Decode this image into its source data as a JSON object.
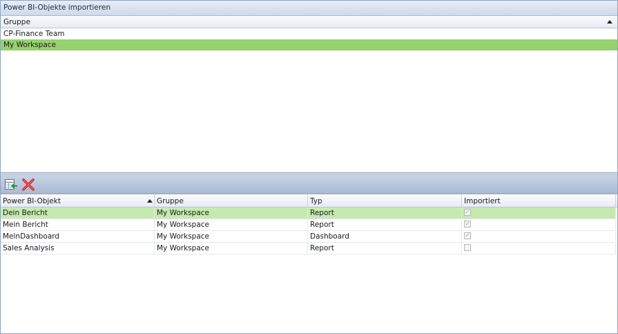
{
  "window": {
    "title": "Power BI-Objekte importieren"
  },
  "groups": {
    "header": "Gruppe",
    "items": [
      {
        "label": "CP-Finance Team",
        "selected": false
      },
      {
        "label": "My Workspace",
        "selected": true
      }
    ]
  },
  "toolbar": {
    "import_icon": "import-table-icon",
    "delete_icon": "red-x-delete-icon"
  },
  "objects": {
    "columns": [
      "Power BI-Objekt",
      "Gruppe",
      "Typ",
      "Importiert"
    ],
    "sort_column": "Power BI-Objekt",
    "rows": [
      {
        "name": "Dein Bericht",
        "group": "My Workspace",
        "type": "Report",
        "imported": true,
        "selected": true
      },
      {
        "name": "Mein Bericht",
        "group": "My Workspace",
        "type": "Report",
        "imported": true,
        "selected": false
      },
      {
        "name": "MeinDashboard",
        "group": "My Workspace",
        "type": "Dashboard",
        "imported": true,
        "selected": false
      },
      {
        "name": "Sales Analysis",
        "group": "My Workspace",
        "type": "Report",
        "imported": false,
        "selected": false
      }
    ]
  },
  "colors": {
    "selected_group": "#95d16f",
    "selected_row": "#c7e9b0",
    "delete_red": "#d62020"
  }
}
